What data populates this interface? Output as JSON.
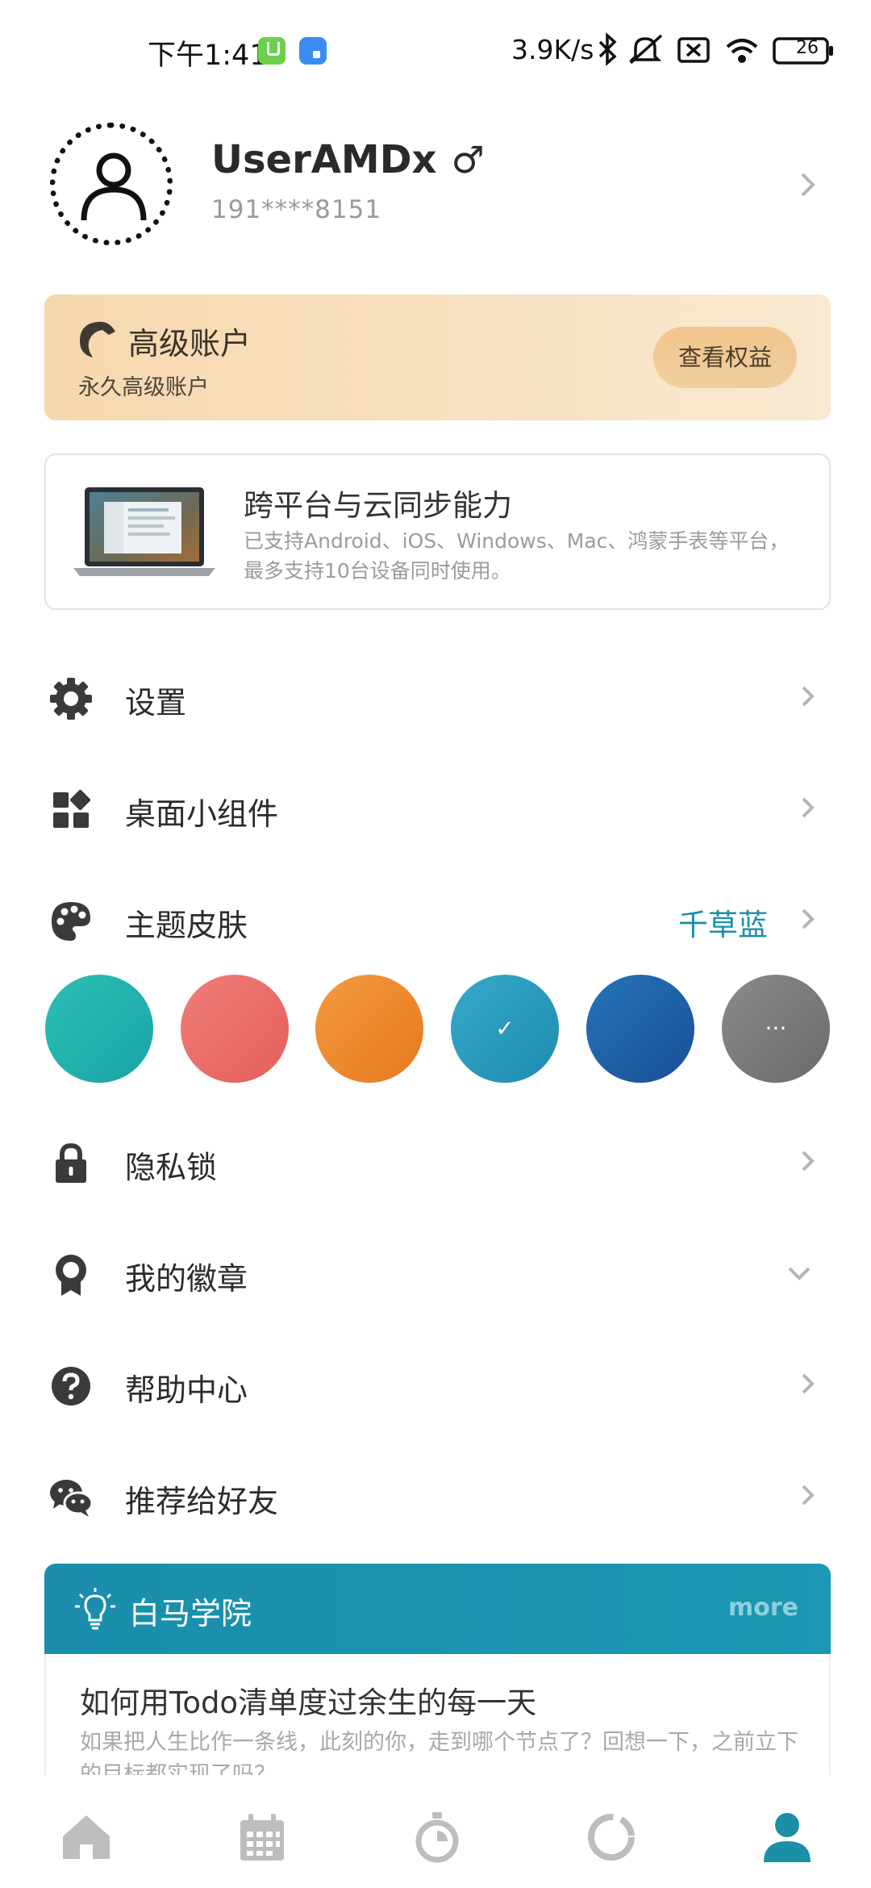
{
  "status_bar": {
    "time": "下午1:41",
    "net_speed": "3.9K/s",
    "battery": "26",
    "icons": [
      "download-badge-icon",
      "app-badge-icon",
      "bluetooth-icon",
      "mute-icon",
      "sim-off-icon",
      "wifi-icon",
      "battery-icon"
    ]
  },
  "profile": {
    "username": "UserAMDx",
    "gender_symbol": "♂",
    "phone": "191****8151"
  },
  "premium": {
    "title": "高级账户",
    "subtitle": "永久高级账户",
    "button": "查看权益"
  },
  "sync": {
    "title": "跨平台与云同步能力",
    "description": "已支持Android、iOS、Windows、Mac、鸿蒙手表等平台，最多支持10台设备同时使用。"
  },
  "menu": {
    "settings": "设置",
    "widgets": "桌面小组件",
    "theme": "主题皮肤",
    "theme_value": "千草蓝",
    "privacy_lock": "隐私锁",
    "badges": "我的徽章",
    "help": "帮助中心",
    "recommend": "推荐给好友"
  },
  "theme_swatches": {
    "colors": [
      "#22b2ad",
      "#ea6e6a",
      "#ee8a2c",
      "#2a9bbd",
      "#1f67a8",
      "#7a7a7a"
    ],
    "selected_mark": "✓",
    "more_mark": "···"
  },
  "academy": {
    "title": "白马学院",
    "more": "more",
    "article_title": "如何用Todo清单度过余生的每一天",
    "article_desc": "如果把人生比作一条线，此刻的你，走到哪个节点了？回想一下，之前立下的目标都实现了吗？"
  },
  "bottom_nav": {
    "tabs": [
      "home-tab",
      "calendar-tab",
      "timer-tab",
      "stats-tab",
      "profile-tab"
    ],
    "active_color": "#1a8fa6",
    "inactive_color": "#bdbdbd"
  }
}
